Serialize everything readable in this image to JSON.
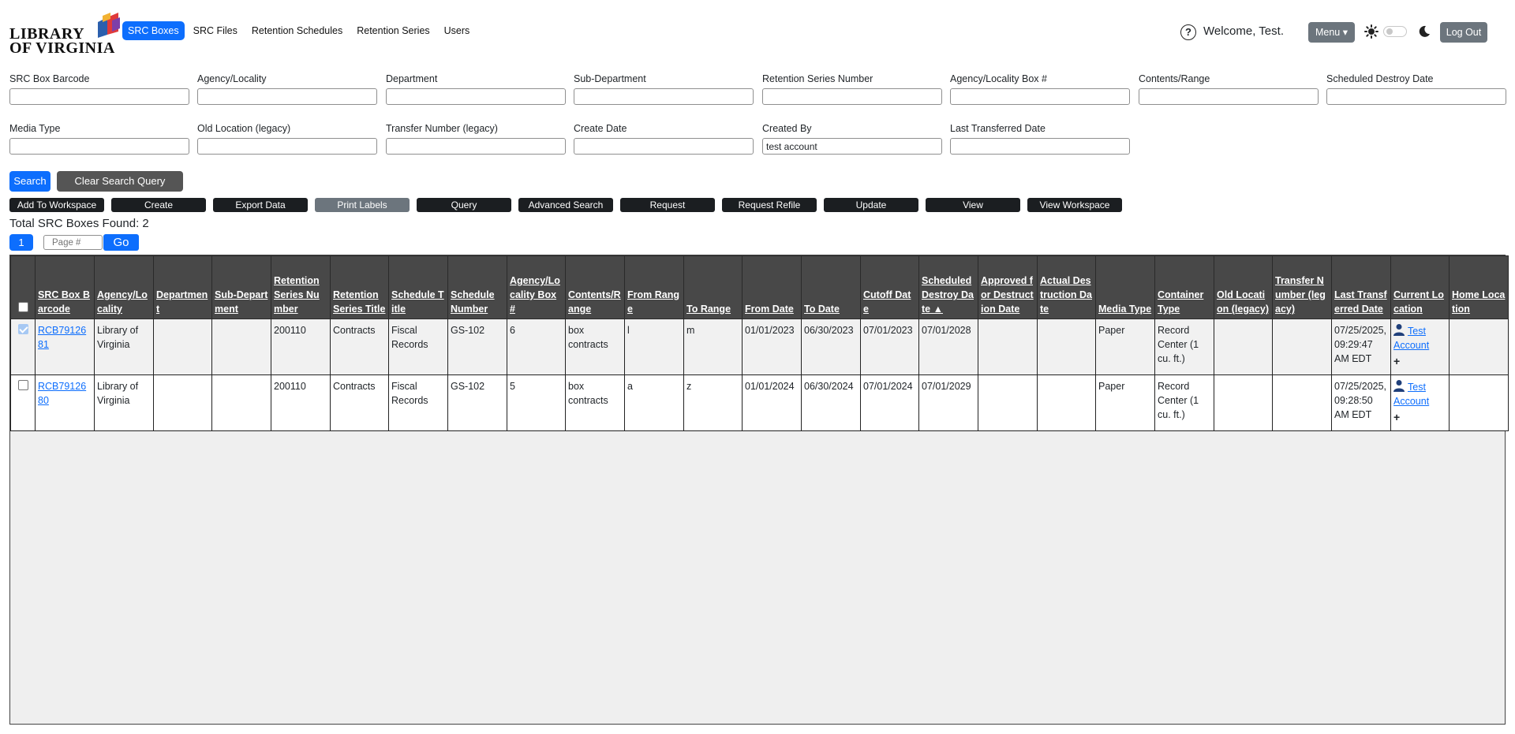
{
  "logo": {
    "line1": "LIBRARY",
    "line2": "OF VIRGINIA"
  },
  "nav": [
    {
      "label": "SRC Boxes",
      "active": true
    },
    {
      "label": "SRC Files"
    },
    {
      "label": "Retention Schedules"
    },
    {
      "label": "Retention Series"
    },
    {
      "label": "Users"
    }
  ],
  "header": {
    "help": "?",
    "welcome": "Welcome, Test.",
    "menu_label": "Menu ▾",
    "logout_label": "Log Out"
  },
  "search": {
    "fields": [
      {
        "label": "SRC Box Barcode",
        "value": ""
      },
      {
        "label": "Agency/Locality",
        "value": ""
      },
      {
        "label": "Department",
        "value": ""
      },
      {
        "label": "Sub-Department",
        "value": ""
      },
      {
        "label": "Retention Series Number",
        "value": ""
      },
      {
        "label": "Agency/Locality Box #",
        "value": ""
      },
      {
        "label": "Contents/Range",
        "value": ""
      },
      {
        "label": "Scheduled Destroy Date",
        "value": ""
      },
      {
        "label": "Media Type",
        "value": ""
      },
      {
        "label": "Old Location (legacy)",
        "value": ""
      },
      {
        "label": "Transfer Number (legacy)",
        "value": ""
      },
      {
        "label": "Create Date",
        "value": ""
      },
      {
        "label": "Created By",
        "value": "test account"
      },
      {
        "label": "Last Transferred Date",
        "value": ""
      }
    ],
    "search_label": "Search",
    "clear_label": "Clear Search Query"
  },
  "actions": [
    {
      "label": "Add To Workspace"
    },
    {
      "label": "Create"
    },
    {
      "label": "Export Data"
    },
    {
      "label": "Print Labels",
      "muted": true
    },
    {
      "label": "Query"
    },
    {
      "label": "Advanced Search"
    },
    {
      "label": "Request"
    },
    {
      "label": "Request Refile"
    },
    {
      "label": "Update"
    },
    {
      "label": "View"
    },
    {
      "label": "View Workspace"
    }
  ],
  "total_text": "Total SRC Boxes Found: 2",
  "pager": {
    "current": "1",
    "placeholder": "Page #",
    "go_label": "Go"
  },
  "table": {
    "columns": [
      "SRC Box Barcode",
      "Agency/Locality",
      "Department",
      "Sub-Department",
      "Retention Series Number",
      "Retention Series Title",
      "Schedule Title",
      "Schedule Number",
      "Agency/Locality Box #",
      "Contents/Range",
      "From Range",
      "To Range",
      "From Date",
      "To Date",
      "Cutoff Date",
      "Scheduled Destroy Date ▲",
      "Approved for Destruction Date",
      "Actual Destruction Date",
      "Media Type",
      "Container Type",
      "Old Location (legacy)",
      "Transfer Number (legacy)",
      "Last Transferred Date",
      "Current Location",
      "Home Location"
    ],
    "rows": [
      {
        "checked": true,
        "cells": [
          "RCB7912681",
          "Library of Virginia",
          "",
          "",
          "200110",
          "Contracts",
          "Fiscal Records",
          "GS-102",
          "6",
          "box contracts",
          "l",
          "m",
          "01/01/2023",
          "06/30/2023",
          "07/01/2023",
          "07/01/2028",
          "",
          "",
          "Paper",
          "Record Center (1 cu. ft.)",
          "",
          "",
          "07/25/2025, 09:29:47 AM EDT",
          "Test Account",
          ""
        ],
        "plus": "+"
      },
      {
        "checked": false,
        "cells": [
          "RCB7912680",
          "Library of Virginia",
          "",
          "",
          "200110",
          "Contracts",
          "Fiscal Records",
          "GS-102",
          "5",
          "box contracts",
          "a",
          "z",
          "01/01/2024",
          "06/30/2024",
          "07/01/2024",
          "07/01/2029",
          "",
          "",
          "Paper",
          "Record Center (1 cu. ft.)",
          "",
          "",
          "07/25/2025, 09:28:50 AM EDT",
          "Test Account",
          ""
        ],
        "plus": "+"
      }
    ]
  }
}
